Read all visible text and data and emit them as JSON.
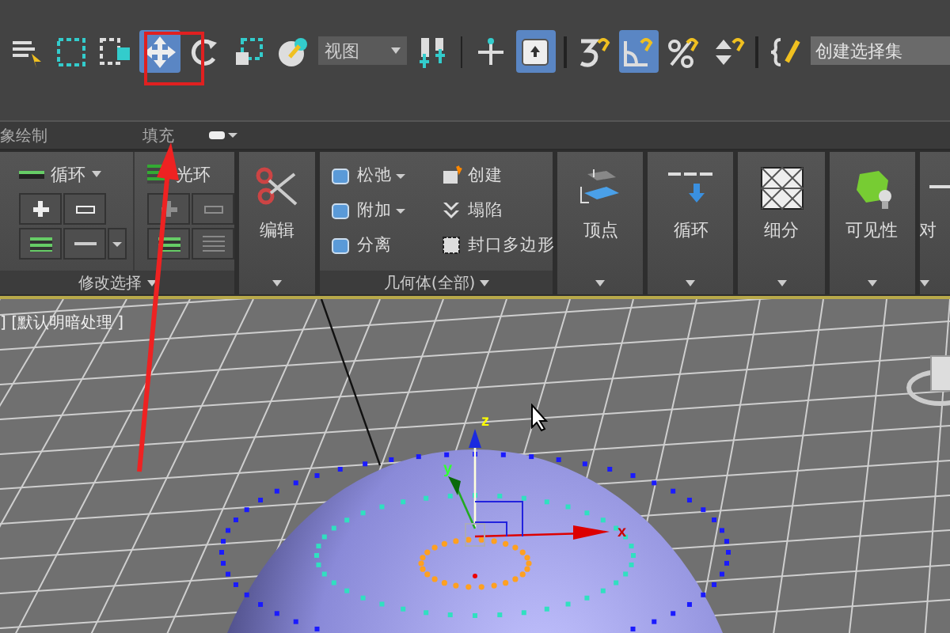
{
  "toolbar": {
    "tools": [
      {
        "kind": "tool",
        "selected": false
      },
      {
        "kind": "tool",
        "selected": false
      },
      {
        "kind": "tool",
        "selected": false
      },
      {
        "kind": "tool",
        "selected": true
      },
      {
        "kind": "tool",
        "selected": false
      },
      {
        "kind": "tool",
        "selected": false
      },
      {
        "kind": "tool",
        "selected": false
      },
      {
        "kind": "dropdown",
        "value": "视图"
      },
      {
        "kind": "tool",
        "selected": false
      },
      {
        "kind": "separator"
      },
      {
        "kind": "tool",
        "selected": false
      },
      {
        "kind": "tool",
        "selected": true
      },
      {
        "kind": "separator"
      },
      {
        "kind": "tool",
        "selected": false
      },
      {
        "kind": "tool",
        "selected": true
      },
      {
        "kind": "tool",
        "selected": false
      },
      {
        "kind": "tool",
        "selected": false
      },
      {
        "kind": "separator"
      },
      {
        "kind": "tool",
        "selected": false
      },
      {
        "kind": "field",
        "placeholder": "创建选择集"
      }
    ]
  },
  "ribbon_tabs": [
    {
      "label": "象绘制"
    },
    {
      "label": "填充"
    }
  ],
  "ribbon": {
    "modify_selection": {
      "loop": "循环",
      "ring": "光环",
      "footer": "修改选择"
    },
    "edit": {
      "label": "编辑"
    },
    "geometry": {
      "items": [
        {
          "label": "松弛",
          "has_menu": true
        },
        {
          "label": "附加",
          "has_menu": true
        },
        {
          "label": "分离",
          "has_menu": false
        },
        {
          "label": "创建",
          "has_menu": false
        },
        {
          "label": "塌陷",
          "has_menu": false
        },
        {
          "label": "封口多边形",
          "has_menu": false
        }
      ],
      "footer": "几何体(全部)"
    },
    "big_buttons": [
      {
        "label": "顶点"
      },
      {
        "label": "循环"
      },
      {
        "label": "细分"
      },
      {
        "label": "可见性"
      },
      {
        "label": "对"
      }
    ]
  },
  "viewport": {
    "label": "] [默认明暗处理 ]",
    "axes": [
      "z",
      "y",
      "x"
    ]
  }
}
